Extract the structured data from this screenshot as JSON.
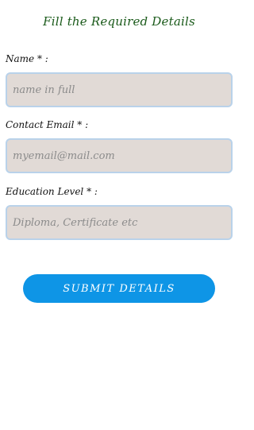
{
  "form": {
    "title": "Fill the Required Details",
    "name": {
      "label": "Name * :",
      "placeholder": "name in full",
      "value": ""
    },
    "email": {
      "label": "Contact Email * :",
      "placeholder": "myemail@mail.com",
      "value": ""
    },
    "education": {
      "label": "Education Level * :",
      "placeholder": "Diploma, Certificate etc",
      "value": ""
    },
    "submit_label": "Submit Details"
  }
}
